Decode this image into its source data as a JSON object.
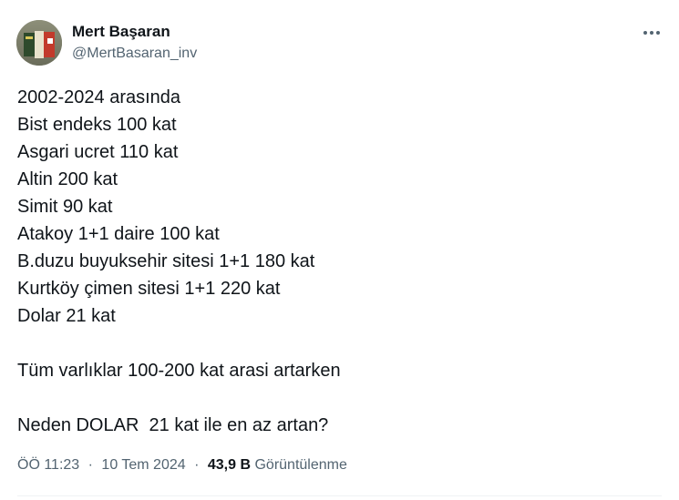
{
  "author": {
    "name": "Mert Başaran",
    "handle": "@MertBasaran_inv"
  },
  "tweet": {
    "lines": [
      "2002-2024 arasında",
      "Bist endeks 100 kat",
      "Asgari ucret 110 kat",
      "Altin 200 kat",
      "Simit 90 kat",
      "Atakoy 1+1 daire 100 kat",
      "B.duzu buyuksehir sitesi 1+1 180 kat",
      "Kurtköy çimen sitesi 1+1 220 kat",
      "Dolar 21 kat",
      "",
      "Tüm varlıklar 100-200 kat arasi artarken",
      "",
      "Neden DOLAR  21 kat ile en az artan?"
    ]
  },
  "meta": {
    "time": "ÖÖ 11:23",
    "separator": "·",
    "date": "10 Tem 2024",
    "views_count": "43,9 B",
    "views_label": "Görüntülenme"
  },
  "icons": {
    "more": "more-dots-icon"
  },
  "colors": {
    "text": "#0f1419",
    "secondary": "#536471",
    "divider": "#eff3f4"
  }
}
